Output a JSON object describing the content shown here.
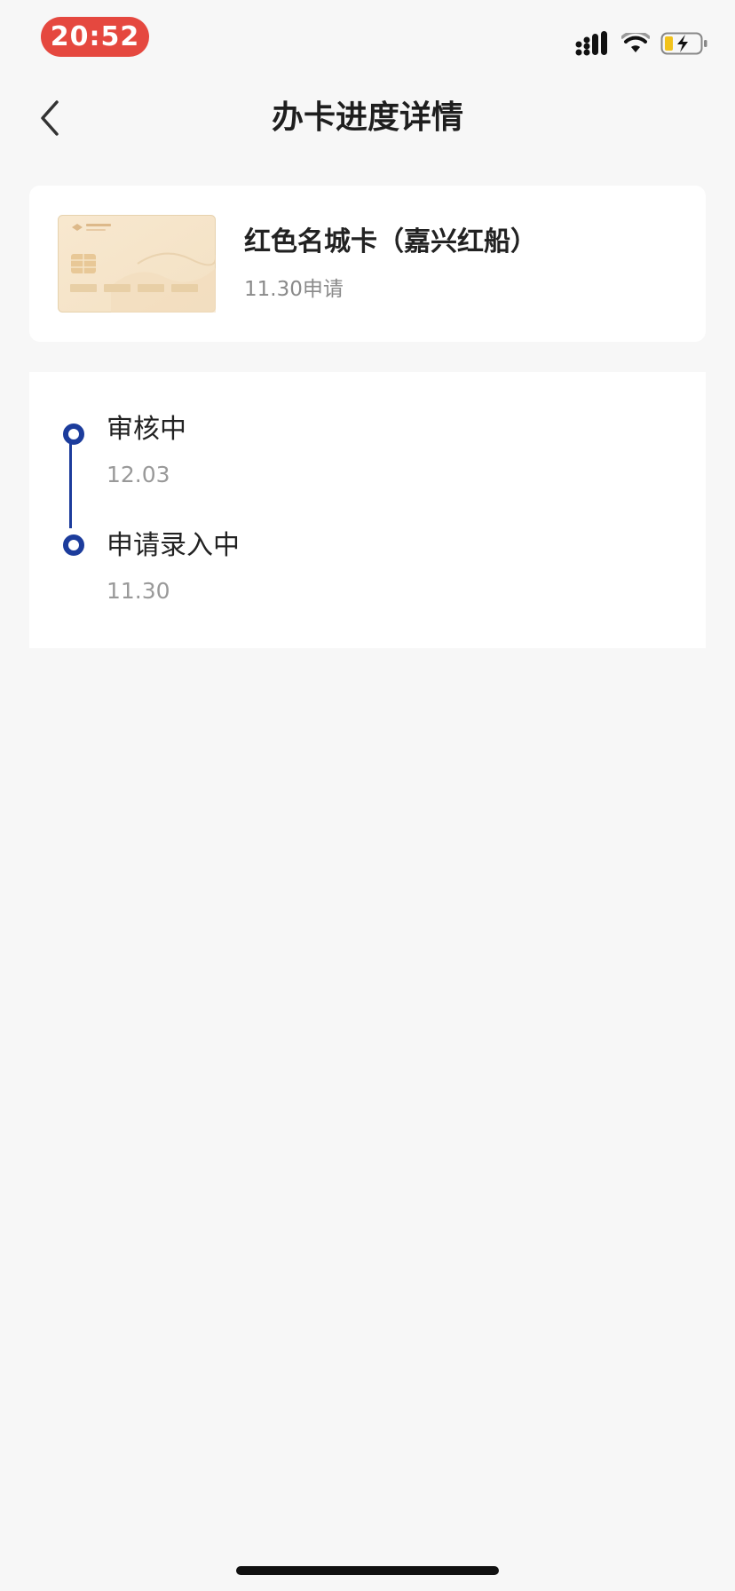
{
  "status_bar": {
    "time": "20:52",
    "icons": [
      "cellular-signal-icon",
      "wifi-icon",
      "battery-charging-icon"
    ],
    "time_pill_color": "#e5483f"
  },
  "nav": {
    "title": "办卡进度详情",
    "back_icon": "chevron-left-icon"
  },
  "card": {
    "name": "红色名城卡（嘉兴红船）",
    "applied_text": "11.30申请",
    "thumbnail_bank_logo": "恒丰银行"
  },
  "progress": {
    "accent_color": "#1c3c9c",
    "steps": [
      {
        "title": "审核中",
        "date": "12.03"
      },
      {
        "title": "申请录入中",
        "date": "11.30"
      }
    ]
  }
}
